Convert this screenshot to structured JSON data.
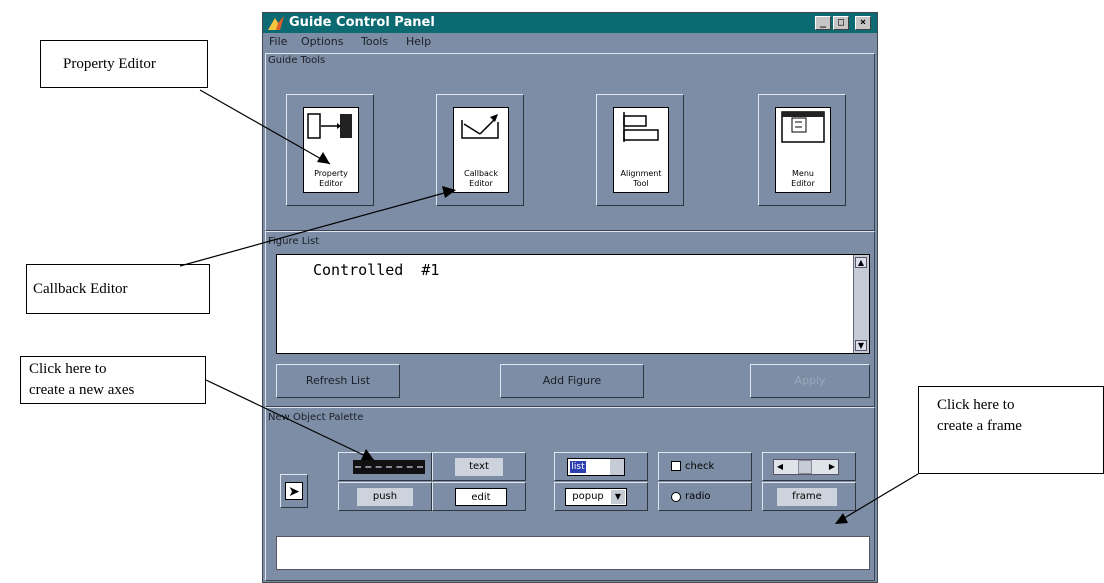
{
  "window": {
    "title": "Guide Control Panel"
  },
  "menu": [
    "File",
    "Options",
    "Tools",
    "Help"
  ],
  "guide_tools": {
    "title": "Guide Tools",
    "buttons": [
      {
        "label": "Property\nEditor",
        "icon": "property-editor-icon"
      },
      {
        "label": "Callback\nEditor",
        "icon": "callback-editor-icon"
      },
      {
        "label": "Alignment\nTool",
        "icon": "alignment-tool-icon"
      },
      {
        "label": "Menu\nEditor",
        "icon": "menu-editor-icon"
      }
    ]
  },
  "figure_list": {
    "title": "Figure List",
    "items": [
      "Controlled  #1"
    ],
    "buttons": {
      "refresh": "Refresh List",
      "add": "Add Figure",
      "apply": "Apply"
    }
  },
  "palette": {
    "title": "New Object Palette",
    "row1": {
      "text": "text",
      "list": "list",
      "check": "check"
    },
    "row2": {
      "push": "push",
      "edit": "edit",
      "popup": "popup",
      "radio": "radio",
      "frame": "frame"
    }
  },
  "callouts": {
    "property_editor": "Property Editor",
    "callback_editor": "Callback Editor",
    "axes": "Click here to\ncreate a new axes",
    "frame": "Click here to\ncreate a frame"
  },
  "colors": {
    "window_bg": "#7d8da5",
    "titlebar": "#0b6a72"
  }
}
